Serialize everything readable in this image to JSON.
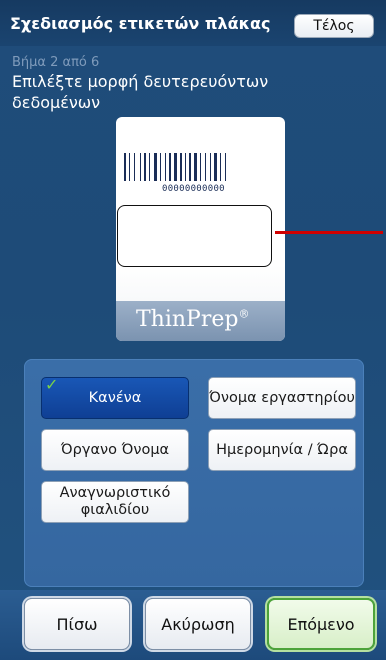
{
  "header": {
    "title": "Σχεδιασμός ετικετών πλάκας",
    "done_label": "Τέλος"
  },
  "wizard": {
    "step": "Βήμα 2 από 6",
    "instruction": "Επιλέξτε μορφή δευτερευόντων δεδομένων"
  },
  "label_preview": {
    "barcode_digits": "00000000000",
    "brand": "ThinPrep",
    "brand_mark": "®",
    "pointer_color": "#d00000"
  },
  "options": [
    {
      "label": "Κανένα",
      "selected": true
    },
    {
      "label": "Όνομα εργαστηρίου",
      "selected": false
    },
    {
      "label": "Όργανο Όνομα",
      "selected": false
    },
    {
      "label": "Ημερομηνία / Ώρα",
      "selected": false
    },
    {
      "label": "Αναγνωριστικό φιαλιδίου",
      "selected": false
    }
  ],
  "footer": {
    "back_label": "Πίσω",
    "cancel_label": "Ακύρωση",
    "next_label": "Επόμενο"
  },
  "colors": {
    "background": "#1f4c7a",
    "selected_option": "#1957b6",
    "next_border": "#4da33a",
    "check_icon": "#7ad04a"
  }
}
